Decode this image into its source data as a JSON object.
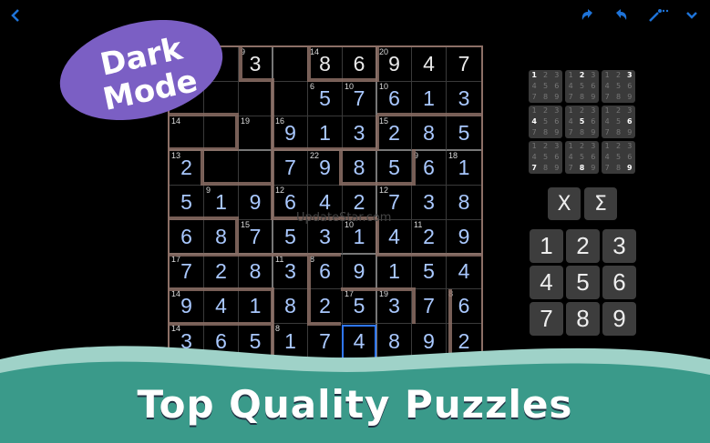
{
  "topbar": {
    "back_icon": "chevron-left-icon",
    "undo_icon": "undo-icon",
    "redo_icon": "redo-icon",
    "wand_icon": "magic-wand-icon",
    "menu_icon": "chevron-down-icon",
    "accent": "#1e73d8"
  },
  "promo_bubble": {
    "line1": "Dark",
    "line2": "Mode",
    "color": "#7b5fc4"
  },
  "watermark": "UpdateStar.com",
  "board": {
    "rows": [
      [
        {
          "v": "",
          "c": ""
        },
        {
          "v": "",
          "c": ""
        },
        {
          "v": "3",
          "c": "9"
        },
        {
          "v": "",
          "c": ""
        },
        {
          "v": "8",
          "c": "14"
        },
        {
          "v": "6",
          "c": ""
        },
        {
          "v": "9",
          "c": "20"
        },
        {
          "v": "4",
          "c": ""
        },
        {
          "v": "7",
          "c": ""
        }
      ],
      [
        {
          "v": "",
          "c": ""
        },
        {
          "v": "",
          "c": ""
        },
        {
          "v": "",
          "c": ""
        },
        {
          "v": "",
          "c": ""
        },
        {
          "v": "5",
          "c": "6"
        },
        {
          "v": "7",
          "c": "10"
        },
        {
          "v": "6",
          "c": "10"
        },
        {
          "v": "1",
          "c": ""
        },
        {
          "v": "3",
          "c": ""
        }
      ],
      [
        {
          "v": "",
          "c": "14"
        },
        {
          "v": "",
          "c": ""
        },
        {
          "v": "",
          "c": "19"
        },
        {
          "v": "9",
          "c": "16"
        },
        {
          "v": "1",
          "c": ""
        },
        {
          "v": "3",
          "c": ""
        },
        {
          "v": "2",
          "c": "15"
        },
        {
          "v": "8",
          "c": ""
        },
        {
          "v": "5",
          "c": ""
        }
      ],
      [
        {
          "v": "2",
          "c": "13"
        },
        {
          "v": "",
          "c": ""
        },
        {
          "v": "",
          "c": ""
        },
        {
          "v": "7",
          "c": ""
        },
        {
          "v": "9",
          "c": "22"
        },
        {
          "v": "8",
          "c": ""
        },
        {
          "v": "5",
          "c": ""
        },
        {
          "v": "6",
          "c": "9"
        },
        {
          "v": "1",
          "c": "18"
        }
      ],
      [
        {
          "v": "5",
          "c": ""
        },
        {
          "v": "1",
          "c": "9"
        },
        {
          "v": "9",
          "c": ""
        },
        {
          "v": "6",
          "c": "12"
        },
        {
          "v": "4",
          "c": ""
        },
        {
          "v": "2",
          "c": ""
        },
        {
          "v": "7",
          "c": "12"
        },
        {
          "v": "3",
          "c": ""
        },
        {
          "v": "8",
          "c": ""
        }
      ],
      [
        {
          "v": "6",
          "c": ""
        },
        {
          "v": "8",
          "c": ""
        },
        {
          "v": "7",
          "c": "15"
        },
        {
          "v": "5",
          "c": ""
        },
        {
          "v": "3",
          "c": ""
        },
        {
          "v": "1",
          "c": "10"
        },
        {
          "v": "4",
          "c": ""
        },
        {
          "v": "2",
          "c": "11"
        },
        {
          "v": "9",
          "c": ""
        }
      ],
      [
        {
          "v": "7",
          "c": "17"
        },
        {
          "v": "2",
          "c": ""
        },
        {
          "v": "8",
          "c": ""
        },
        {
          "v": "3",
          "c": "11"
        },
        {
          "v": "6",
          "c": "8"
        },
        {
          "v": "9",
          "c": ""
        },
        {
          "v": "1",
          "c": ""
        },
        {
          "v": "5",
          "c": ""
        },
        {
          "v": "4",
          "c": ""
        }
      ],
      [
        {
          "v": "9",
          "c": "14"
        },
        {
          "v": "4",
          "c": ""
        },
        {
          "v": "1",
          "c": ""
        },
        {
          "v": "8",
          "c": ""
        },
        {
          "v": "2",
          "c": ""
        },
        {
          "v": "5",
          "c": "17"
        },
        {
          "v": "3",
          "c": "19"
        },
        {
          "v": "7",
          "c": ""
        },
        {
          "v": "6",
          "c": "8"
        }
      ],
      [
        {
          "v": "3",
          "c": "14"
        },
        {
          "v": "6",
          "c": ""
        },
        {
          "v": "5",
          "c": ""
        },
        {
          "v": "1",
          "c": "8"
        },
        {
          "v": "7",
          "c": ""
        },
        {
          "v": "4",
          "c": ""
        },
        {
          "v": "8",
          "c": ""
        },
        {
          "v": "9",
          "c": ""
        },
        {
          "v": "2",
          "c": ""
        }
      ]
    ],
    "selected_cell": "row 9, column 6",
    "digit_color": "#a9c8ff",
    "cage_color": "#8c6f66",
    "selection_color": "#2f77ff"
  },
  "candidates": [
    {
      "active": 1
    },
    {
      "active": 2
    },
    {
      "active": 3
    },
    {
      "active": 4
    },
    {
      "active": 5
    },
    {
      "active": 6
    },
    {
      "active": 7
    },
    {
      "active": 8
    },
    {
      "active": 9
    }
  ],
  "candidate_digits": [
    "1",
    "2",
    "3",
    "4",
    "5",
    "6",
    "7",
    "8",
    "9"
  ],
  "tools": {
    "clear_label": "X",
    "sum_label": "Σ"
  },
  "keypad": [
    "1",
    "2",
    "3",
    "4",
    "5",
    "6",
    "7",
    "8",
    "9"
  ],
  "footer": {
    "title": "Top Quality Puzzles",
    "wave_color": "#3a9a8a",
    "wave_light": "#9fd2c8"
  }
}
